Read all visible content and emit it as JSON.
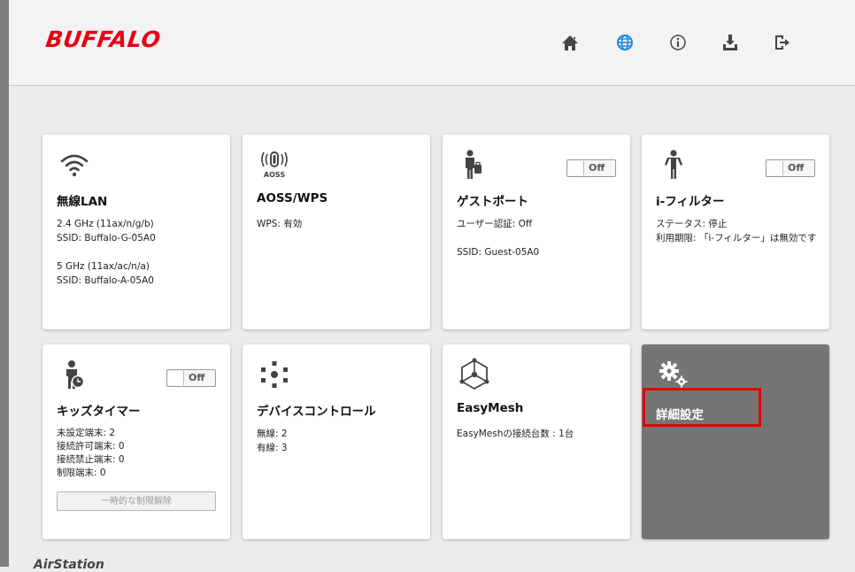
{
  "header": {
    "logo": "BUFFALO",
    "icons": [
      "home-icon",
      "globe-icon",
      "info-icon",
      "download-icon",
      "logout-icon"
    ],
    "accent": "#e60012",
    "globe_color": "#1e88e5"
  },
  "tiles": {
    "wireless": {
      "title": "無線LAN",
      "band1": "2.4 GHz (11ax/n/g/b)",
      "ssid1": "SSID: Buffalo-G-05A0",
      "band2": "5 GHz (11ax/ac/n/a)",
      "ssid2": "SSID: Buffalo-A-05A0"
    },
    "aoss": {
      "icon_label": "AOSS",
      "title": "AOSS/WPS",
      "status": "WPS: 有効"
    },
    "guest": {
      "title": "ゲストポート",
      "toggle": "Off",
      "auth": "ユーザー認証: Off",
      "ssid": "SSID: Guest-05A0"
    },
    "ifilter": {
      "title": "i-フィルター",
      "toggle": "Off",
      "status": "ステータス: 停止",
      "period": "利用期限: 「i-フィルター」は無効です"
    },
    "kids": {
      "title": "キッズタイマー",
      "toggle": "Off",
      "unset": "未設定端末: 2",
      "allowed": "接続許可端末: 0",
      "blocked": "接続禁止端末: 0",
      "limited": "制限端末: 0",
      "release_button": "一時的な制限解除"
    },
    "device": {
      "title": "デバイスコントロール",
      "wireless": "無線: 2",
      "wired": "有線: 3"
    },
    "mesh": {
      "title": "EasyMesh",
      "count": "EasyMeshの接続台数 : 1台"
    },
    "advanced": {
      "title": "詳細設定"
    }
  },
  "footer": {
    "logo": "AirStation"
  }
}
